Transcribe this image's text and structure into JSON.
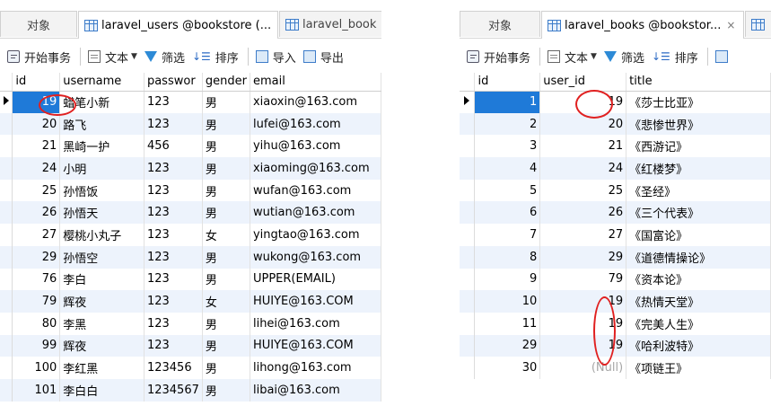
{
  "left": {
    "tabs": [
      {
        "label": "对象"
      },
      {
        "label": "laravel_users @bookstore (..."
      },
      {
        "label": "laravel_book"
      }
    ],
    "toolbar": {
      "begin": "开始事务",
      "text": "文本",
      "filter": "筛选",
      "sort": "排序",
      "import": "导入",
      "export": "导出"
    },
    "columns": [
      "id",
      "username",
      "passwor",
      "gender",
      "email"
    ],
    "rows": [
      [
        "19",
        "蜡笔小新",
        "123",
        "男",
        "xiaoxin@163.com"
      ],
      [
        "20",
        "路飞",
        "123",
        "男",
        "lufei@163.com"
      ],
      [
        "21",
        "黑崎一护",
        "456",
        "男",
        "yihu@163.com"
      ],
      [
        "24",
        "小明",
        "123",
        "男",
        "xiaoming@163.com"
      ],
      [
        "25",
        "孙悟饭",
        "123",
        "男",
        "wufan@163.com"
      ],
      [
        "26",
        "孙悟天",
        "123",
        "男",
        "wutian@163.com"
      ],
      [
        "27",
        "樱桃小丸子",
        "123",
        "女",
        "yingtao@163.com"
      ],
      [
        "29",
        "孙悟空",
        "123",
        "男",
        "wukong@163.com"
      ],
      [
        "76",
        "李白",
        "123",
        "男",
        "UPPER(EMAIL)"
      ],
      [
        "79",
        "辉夜",
        "123",
        "女",
        "HUIYE@163.COM"
      ],
      [
        "80",
        "李黑",
        "123",
        "男",
        "lihei@163.com"
      ],
      [
        "99",
        "辉夜",
        "123",
        "男",
        "HUIYE@163.COM"
      ],
      [
        "100",
        "李红黑",
        "123456",
        "男",
        "lihong@163.com"
      ],
      [
        "101",
        "李白白",
        "1234567",
        "男",
        "libai@163.com"
      ]
    ]
  },
  "right": {
    "tabs": [
      {
        "label": "对象"
      },
      {
        "label": "laravel_books @bookstor..."
      }
    ],
    "toolbar": {
      "begin": "开始事务",
      "text": "文本",
      "filter": "筛选",
      "sort": "排序"
    },
    "columns": [
      "id",
      "user_id",
      "title"
    ],
    "rows": [
      [
        "1",
        "19",
        "《莎士比亚》"
      ],
      [
        "2",
        "20",
        "《悲惨世界》"
      ],
      [
        "3",
        "21",
        "《西游记》"
      ],
      [
        "4",
        "24",
        "《红楼梦》"
      ],
      [
        "5",
        "25",
        "《圣经》"
      ],
      [
        "6",
        "26",
        "《三个代表》"
      ],
      [
        "7",
        "27",
        "《国富论》"
      ],
      [
        "8",
        "29",
        "《道德情操论》"
      ],
      [
        "9",
        "79",
        "《资本论》"
      ],
      [
        "10",
        "19",
        "《热情天堂》"
      ],
      [
        "11",
        "19",
        "《完美人生》"
      ],
      [
        "29",
        "19",
        "《哈利波特》"
      ],
      [
        "30",
        "(Null)",
        "《项链王》"
      ]
    ]
  },
  "colors": {
    "selection": "#1f7ad8",
    "annotation": "#e02020",
    "alt_row": "#edf3fc"
  }
}
